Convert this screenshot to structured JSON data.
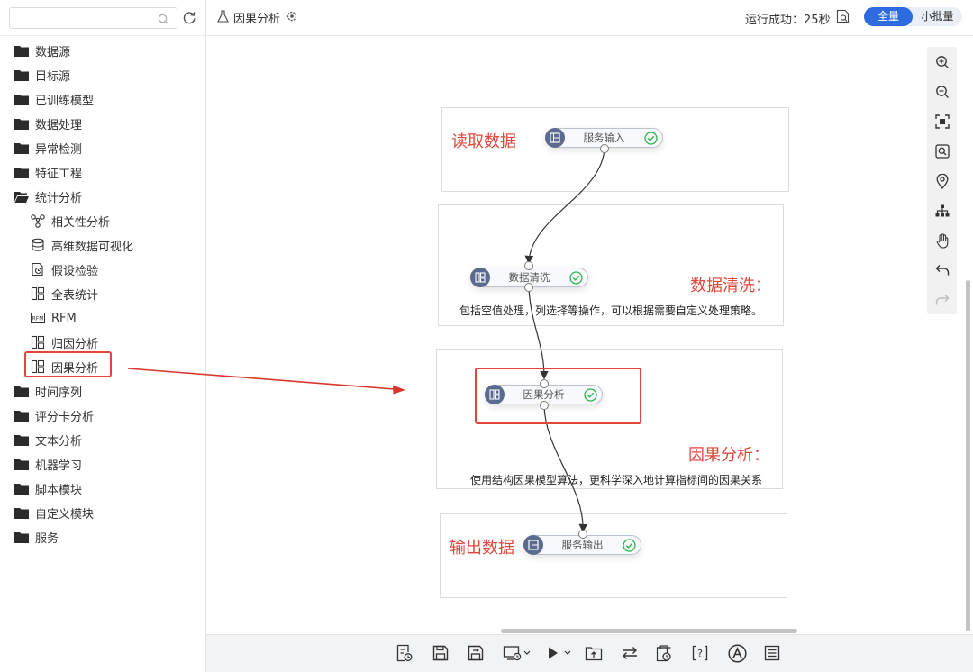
{
  "sidebar": {
    "search": {
      "placeholder": "",
      "value": ""
    },
    "tree": [
      {
        "label": "数据源",
        "level": 0,
        "icon": "folder-icon"
      },
      {
        "label": "目标源",
        "level": 0,
        "icon": "folder-icon"
      },
      {
        "label": "已训练模型",
        "level": 0,
        "icon": "folder-icon"
      },
      {
        "label": "数据处理",
        "level": 0,
        "icon": "folder-icon"
      },
      {
        "label": "异常检测",
        "level": 0,
        "icon": "folder-icon"
      },
      {
        "label": "特征工程",
        "level": 0,
        "icon": "folder-icon"
      },
      {
        "label": "统计分析",
        "level": 0,
        "icon": "folder-open-icon"
      },
      {
        "label": "相关性分析",
        "level": 1,
        "icon": "correlation-icon"
      },
      {
        "label": "高维数据可视化",
        "level": 1,
        "icon": "database-icon"
      },
      {
        "label": "假设检验",
        "level": 1,
        "icon": "hypothesis-icon"
      },
      {
        "label": "全表统计",
        "level": 1,
        "icon": "layout-icon"
      },
      {
        "label": "RFM",
        "level": 1,
        "icon": "rfm-icon"
      },
      {
        "label": "归因分析",
        "level": 1,
        "icon": "layout-icon"
      },
      {
        "label": "因果分析",
        "level": 1,
        "icon": "layout-icon"
      },
      {
        "label": "时间序列",
        "level": 0,
        "icon": "folder-icon"
      },
      {
        "label": "评分卡分析",
        "level": 0,
        "icon": "folder-icon"
      },
      {
        "label": "文本分析",
        "level": 0,
        "icon": "folder-icon"
      },
      {
        "label": "机器学习",
        "level": 0,
        "icon": "folder-icon"
      },
      {
        "label": "脚本模块",
        "level": 0,
        "icon": "folder-icon"
      },
      {
        "label": "自定义模块",
        "level": 0,
        "icon": "folder-icon"
      },
      {
        "label": "服务",
        "level": 0,
        "icon": "folder-icon"
      }
    ],
    "highlighted_item": "因果分析"
  },
  "header": {
    "title": "因果分析",
    "status": "运行成功：25秒",
    "modes": {
      "active": "全量",
      "inactive": "小批量"
    }
  },
  "canvas": {
    "groups": [
      {
        "title": "读取数据",
        "description": ""
      },
      {
        "title": "数据清洗：",
        "description": "包括空值处理，列选择等操作，可以根据需要自定义处理策略。"
      },
      {
        "title": "因果分析：",
        "description": "使用结构因果模型算法，更科学深入地计算指标间的因果关系"
      },
      {
        "title": "输出数据",
        "description": ""
      }
    ],
    "nodes": [
      {
        "label": "服务输入",
        "status": "success"
      },
      {
        "label": "数据清洗",
        "status": "success"
      },
      {
        "label": "因果分析",
        "status": "success"
      },
      {
        "label": "服务输出",
        "status": "success"
      }
    ]
  },
  "colors": {
    "accent": "#2f6be0",
    "annotation_red": "#e0463a",
    "node_icon_bg": "#5b6b8f",
    "success_green": "#2bb44a"
  },
  "right_tools": [
    "zoom-in-icon",
    "zoom-out-icon",
    "fit-view-icon",
    "search-node-icon",
    "locate-icon",
    "layout-tree-icon",
    "pan-hand-icon",
    "undo-icon",
    "redo-icon"
  ],
  "bottom_tools": [
    "run-log-icon",
    "save-icon",
    "save-as-icon",
    "schedule-icon",
    "run-icon",
    "export-icon",
    "sync-icon",
    "history-icon",
    "help-icon",
    "assistant-icon",
    "notes-icon"
  ]
}
